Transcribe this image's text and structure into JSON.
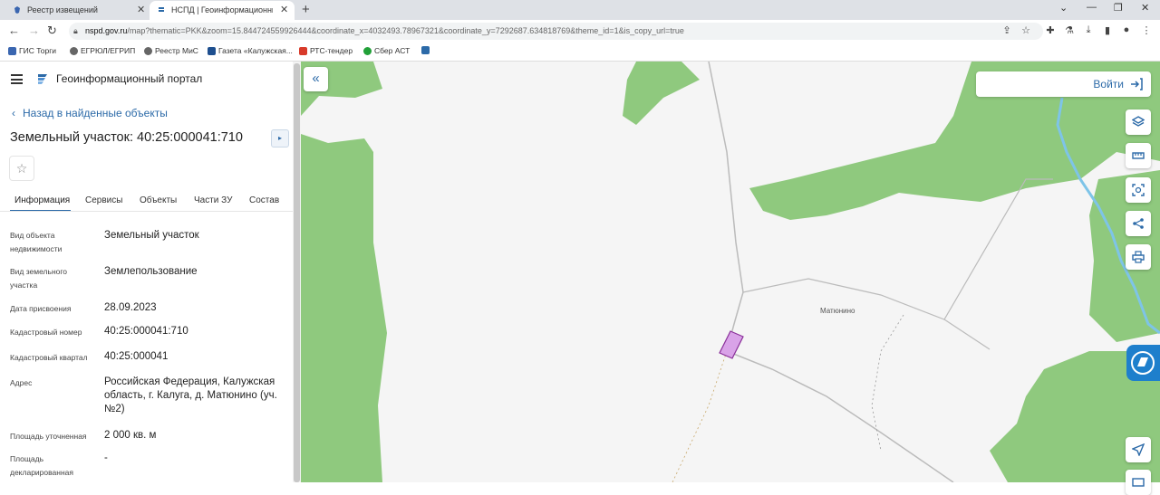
{
  "browser": {
    "tabs": [
      {
        "title": "Реестр извещений",
        "close": "✕"
      },
      {
        "title": "НСПД | Геоинформационный п",
        "close": "✕"
      }
    ],
    "new_tab": "+",
    "url_host": "nspd.gov.ru",
    "url_rest": "/map?thematic=PKK&zoom=15.844724559926444&coordinate_x=4032493.78967321&coordinate_y=7292687.634818769&theme_id=1&is_copy_url=true",
    "bookmarks": [
      "ГИС Торги",
      "ЕГРЮЛ/ЕГРИП",
      "Реестр МиС",
      "Газета «Калужская...",
      "РТС-тендер",
      "Сбер АСТ"
    ]
  },
  "panel": {
    "portal_name": "Геоинформационный портал",
    "back_label": "Назад в найденные объекты",
    "title": "Земельный участок: 40:25:000041:710",
    "tabs": [
      "Информация",
      "Сервисы",
      "Объекты",
      "Части ЗУ",
      "Состав"
    ],
    "fields": [
      {
        "label": "Вид объекта недвижимости",
        "value": "Земельный участок"
      },
      {
        "label": "Вид земельного участка",
        "value": "Землепользование"
      },
      {
        "label": "Дата присвоения",
        "value": "28.09.2023"
      },
      {
        "label": "Кадастровый номер",
        "value": "40:25:000041:710"
      },
      {
        "label": "Кадастровый квартал",
        "value": "40:25:000041"
      },
      {
        "label": "Адрес",
        "value": "Российская Федерация, Калужская область, г. Калуга, д. Матюнино (уч. №2)"
      },
      {
        "label": "Площадь уточненная",
        "value": "2 000 кв. м"
      },
      {
        "label": "Площадь декларированная",
        "value": "-"
      }
    ]
  },
  "map": {
    "login_label": "Войти",
    "place_label": "Матюнино"
  },
  "colors": {
    "accent": "#2c6aa8",
    "forest": "#8fc97e",
    "river": "#7ec4e8",
    "parcel": "#d9a3e8"
  }
}
